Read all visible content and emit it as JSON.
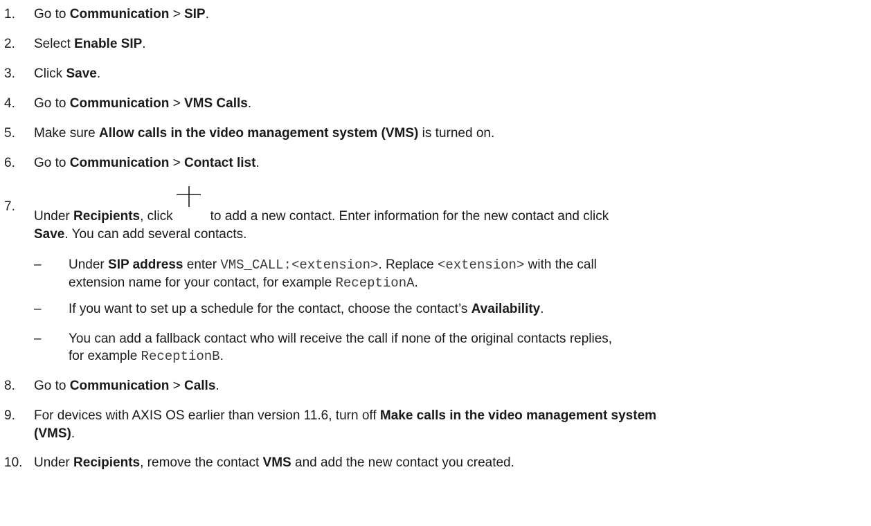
{
  "steps": [
    {
      "n": "1.",
      "a": "Go to ",
      "b": "Communication",
      "c": " > ",
      "d": "SIP",
      "e": "."
    },
    {
      "n": "2.",
      "a": "Select ",
      "b": "Enable SIP",
      "c": "."
    },
    {
      "n": "3.",
      "a": "Click ",
      "b": "Save",
      "c": "."
    },
    {
      "n": "4.",
      "a": "Go to ",
      "b": "Communication",
      "c": " > ",
      "d": "VMS Calls",
      "e": "."
    },
    {
      "n": "5.",
      "a": "Make sure ",
      "b": "Allow calls in the video management system (VMS)",
      "c": " is turned on."
    },
    {
      "n": "6.",
      "a": "Go to ",
      "b": "Communication",
      "c": " > ",
      "d": "Contact list",
      "e": "."
    },
    {
      "n": "7.",
      "a": "Under ",
      "b": "Recipients",
      "c": ", click",
      "d": "to add a new contact. Enter information for the new contact and click",
      "e": "Save",
      "f": ". You can add several contacts."
    },
    {
      "n": "8.",
      "a": "Go to ",
      "b": "Communication",
      "c": " > ",
      "d": "Calls",
      "e": "."
    },
    {
      "n": "9.",
      "a": "For devices with AXIS OS earlier than version 11.6, turn off ",
      "b": "Make calls in the video management system",
      "c": "(VMS)",
      "d": "."
    },
    {
      "n": "10.",
      "a": "Under ",
      "b": "Recipients",
      "c": ", remove the contact ",
      "d": "VMS",
      "e": " and add the new contact you created."
    }
  ],
  "substeps": [
    {
      "dash": "–",
      "a": "Under ",
      "b": "SIP address",
      "c": " enter ",
      "d": "VMS_CALL:<extension>",
      "e": ". Replace ",
      "f": "<extension>",
      "g": " with the call",
      "h": "extension name for your contact, for example ",
      "i": "ReceptionA",
      "j": "."
    },
    {
      "dash": "–",
      "a": "If you want to set up a schedule for the contact, choose the contact’s ",
      "b": "Availability",
      "c": "."
    },
    {
      "dash": "–",
      "a": "You can add a fallback contact who will receive the call if none of the original contacts replies,",
      "b": "for example ",
      "c": "ReceptionB",
      "d": "."
    }
  ],
  "icons": {
    "add": "plus-icon"
  }
}
